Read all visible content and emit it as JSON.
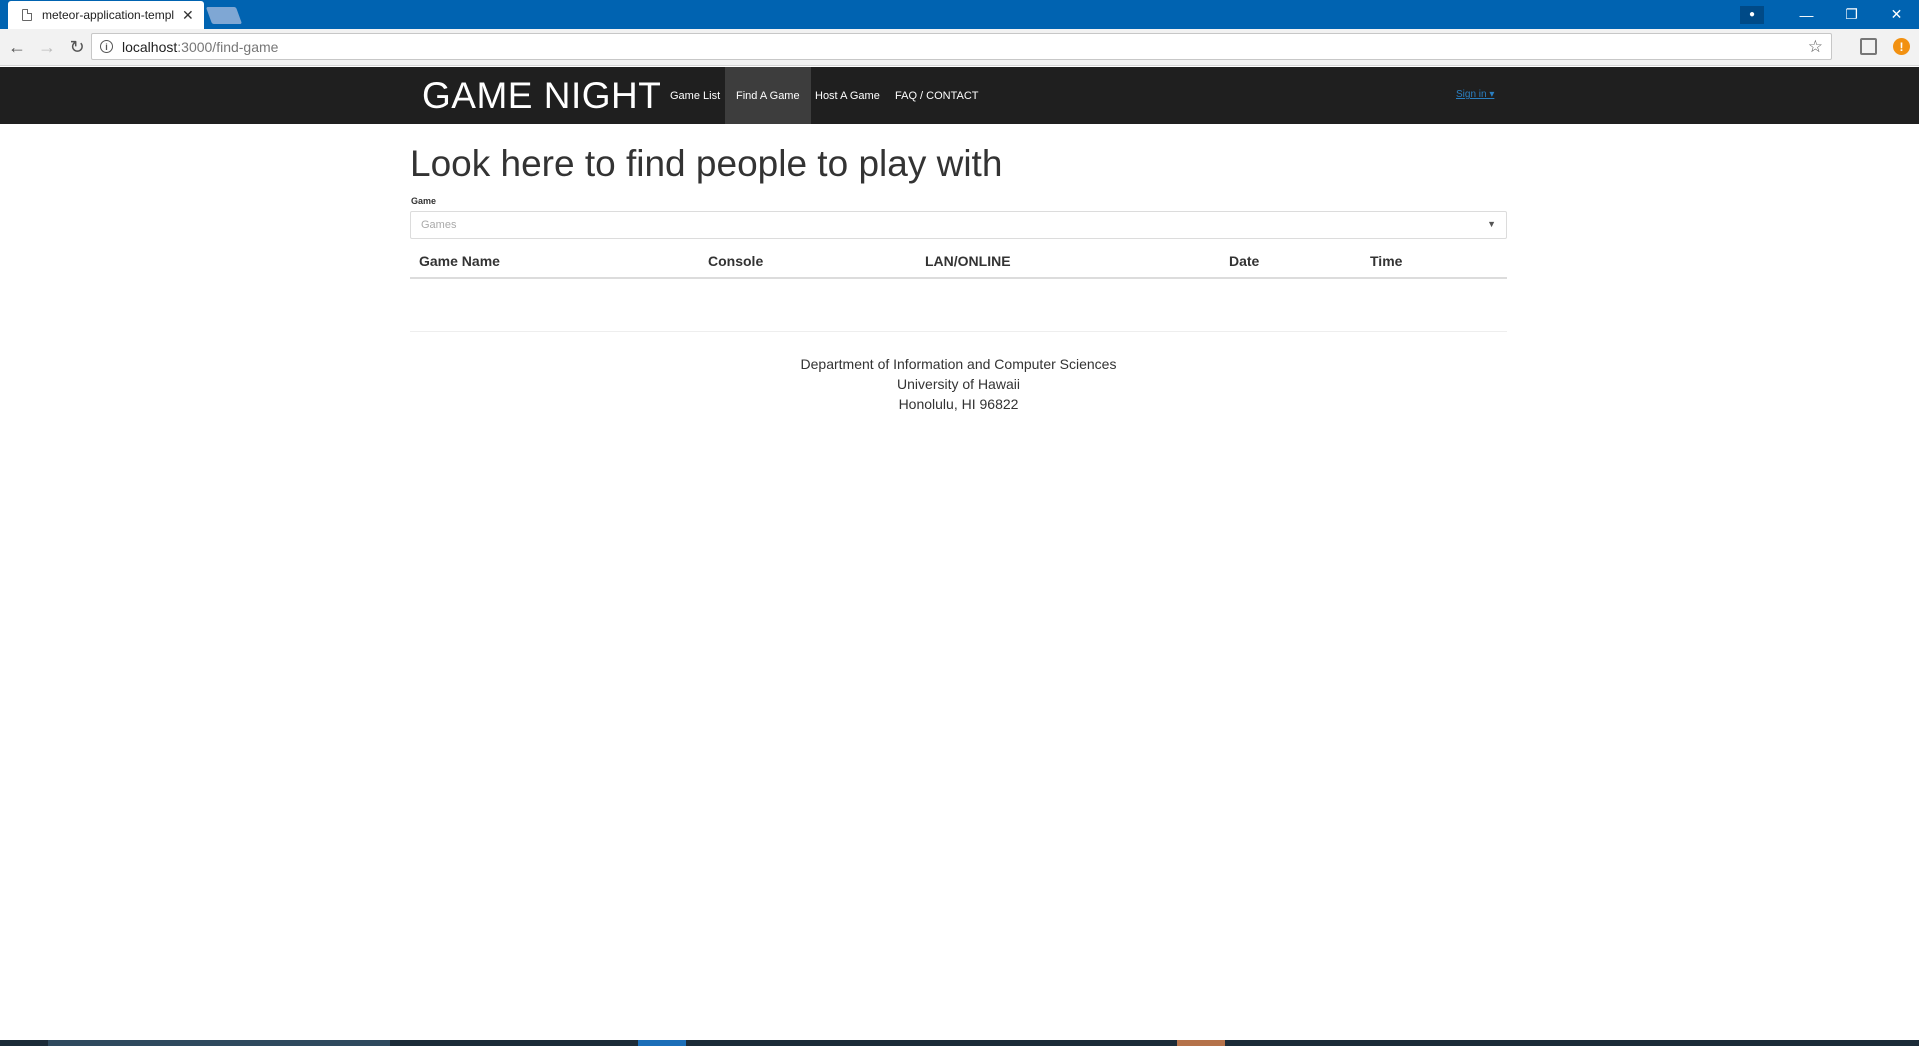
{
  "browser": {
    "tab_title": "meteor-application-template",
    "tab_close": "✕",
    "url_host": "localhost",
    "url_path": ":3000/find-game",
    "win_controls": [
      "—",
      "❐",
      "✕"
    ]
  },
  "navbar": {
    "brand": "GAME NIGHT",
    "items": [
      {
        "label": "Game List",
        "active": false
      },
      {
        "label": "Find A Game",
        "active": true
      },
      {
        "label": "Host A Game",
        "active": false
      },
      {
        "label": "FAQ / CONTACT",
        "active": false
      }
    ],
    "signin": "Sign in ▾"
  },
  "main": {
    "title": "Look here to find people to play with",
    "game_field": {
      "label": "Game",
      "placeholder": "Games"
    },
    "table": {
      "headers": [
        "Game Name",
        "Console",
        "LAN/ONLINE",
        "Date",
        "Time"
      ],
      "rows": []
    }
  },
  "footer": {
    "lines": [
      "Department of Information and Computer Sciences",
      "University of Hawaii",
      "Honolulu, HI 96822"
    ]
  },
  "colors": {
    "titlebar": "#0063b1",
    "navbar": "#1f1f1f",
    "nav_active": "#3d3d3d",
    "link": "#2a7fc1"
  }
}
